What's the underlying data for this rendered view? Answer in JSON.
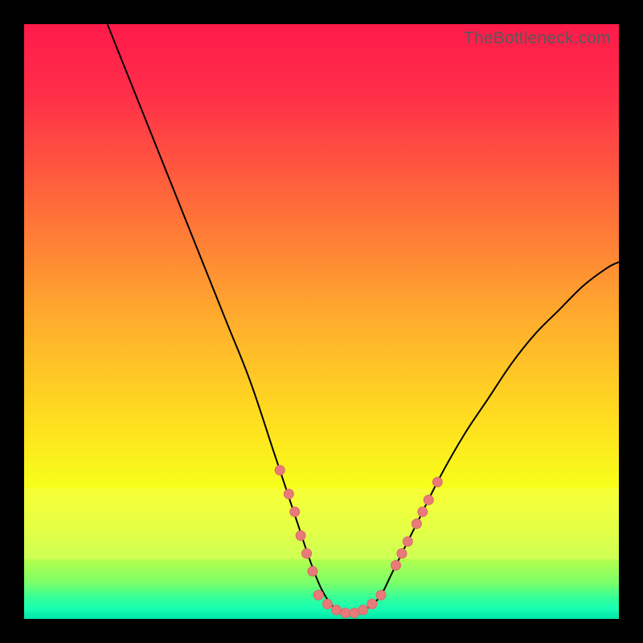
{
  "watermark": "TheBottleneck.com",
  "gradient_stops": [
    {
      "offset": 0.0,
      "color": "#ff1a4a"
    },
    {
      "offset": 0.12,
      "color": "#ff2f49"
    },
    {
      "offset": 0.3,
      "color": "#ff6a3a"
    },
    {
      "offset": 0.5,
      "color": "#ffae2d"
    },
    {
      "offset": 0.68,
      "color": "#ffe21e"
    },
    {
      "offset": 0.78,
      "color": "#f6ff1a"
    },
    {
      "offset": 0.85,
      "color": "#d9ff33"
    },
    {
      "offset": 0.9,
      "color": "#b4ff4d"
    },
    {
      "offset": 0.94,
      "color": "#7aff6a"
    },
    {
      "offset": 0.965,
      "color": "#33ff99"
    },
    {
      "offset": 0.982,
      "color": "#1affb3"
    },
    {
      "offset": 1.0,
      "color": "#00e6a8"
    }
  ],
  "yellow_band": {
    "top_frac": 0.78,
    "bottom_frac": 0.9,
    "color": "#f8ff66",
    "opacity": 0.35
  },
  "curve_color": "#000000",
  "curve_width": 2,
  "marker": {
    "fill": "#e87a7a",
    "stroke": "#d86a6a",
    "r": 6
  },
  "chart_data": {
    "type": "line",
    "title": "",
    "xlabel": "",
    "ylabel": "",
    "xlim": [
      0,
      100
    ],
    "ylim": [
      0,
      100
    ],
    "grid": false,
    "legend": false,
    "annotations": [
      "TheBottleneck.com"
    ],
    "series": [
      {
        "name": "curve",
        "x": [
          14,
          18,
          22,
          26,
          30,
          34,
          38,
          42,
          44,
          46,
          48,
          50,
          52,
          54,
          56,
          58,
          60,
          62,
          66,
          70,
          74,
          78,
          82,
          86,
          90,
          94,
          98,
          100
        ],
        "y": [
          100,
          90,
          80,
          70,
          60,
          50,
          40,
          28,
          22,
          16,
          10,
          5,
          2,
          1,
          1,
          2,
          4,
          8,
          16,
          24,
          31,
          37,
          43,
          48,
          52,
          56,
          59,
          60
        ]
      },
      {
        "name": "markers-left",
        "x": [
          43,
          44.5,
          45.5,
          46.5,
          47.5,
          48.5
        ],
        "y": [
          25,
          21,
          18,
          14,
          11,
          8
        ]
      },
      {
        "name": "markers-bottom",
        "x": [
          49.5,
          51,
          52.5,
          54,
          55.5,
          57,
          58.5,
          60
        ],
        "y": [
          4,
          2.5,
          1.5,
          1,
          1,
          1.5,
          2.5,
          4
        ]
      },
      {
        "name": "markers-right",
        "x": [
          62.5,
          63.5,
          64.5,
          66,
          67,
          68,
          69.5
        ],
        "y": [
          9,
          11,
          13,
          16,
          18,
          20,
          23
        ]
      }
    ]
  }
}
